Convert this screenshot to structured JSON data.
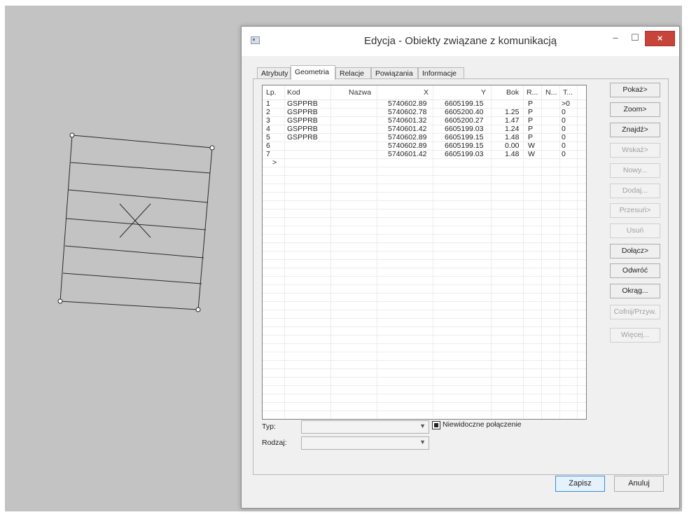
{
  "dialog": {
    "title": "Edycja - Obiekty związane z komunikacją",
    "window_controls": {
      "minimize": "–",
      "maximize": "☐",
      "close": "×"
    }
  },
  "tabs": [
    "Atrybuty",
    "Geometria",
    "Relacje",
    "Powiązania",
    "Informacje"
  ],
  "active_tab": "Geometria",
  "table": {
    "headers": [
      "Lp.",
      "Kod",
      "Nazwa",
      "X",
      "Y",
      "Bok",
      "R...",
      "N...",
      "T..."
    ],
    "rows": [
      [
        "1",
        "GSPPRB",
        "",
        "5740602.89",
        "6605199.15",
        "",
        "P",
        "",
        ">0"
      ],
      [
        "2",
        "GSPPRB",
        "",
        "5740602.78",
        "6605200.40",
        "1.25",
        "P",
        "",
        "0"
      ],
      [
        "3",
        "GSPPRB",
        "",
        "5740601.32",
        "6605200.27",
        "1.47",
        "P",
        "",
        "0"
      ],
      [
        "4",
        "GSPPRB",
        "",
        "5740601.42",
        "6605199.03",
        "1.24",
        "P",
        "",
        "0"
      ],
      [
        "5",
        "GSPPRB",
        "",
        "5740602.89",
        "6605199.15",
        "1.48",
        "P",
        "",
        "0"
      ],
      [
        "6",
        "",
        "",
        "5740602.89",
        "6605199.15",
        "0.00",
        "W",
        "",
        "0"
      ],
      [
        "7",
        "",
        "",
        "5740601.42",
        "6605199.03",
        "1.48",
        "W",
        "",
        "0"
      ]
    ],
    "new_row_marker": ">"
  },
  "fields": {
    "typ_label": "Typ:",
    "typ_value": "",
    "rodzaj_label": "Rodzaj:",
    "rodzaj_value": "",
    "checkbox_label": "Niewidoczne połączenie",
    "checkbox_checked": true
  },
  "side_buttons": [
    {
      "label": "Pokaż>",
      "enabled": true
    },
    {
      "label": "Zoom>",
      "enabled": true
    },
    {
      "label": "Znajdź>",
      "enabled": true
    },
    {
      "label": "Wskaż>",
      "enabled": false
    },
    {
      "label": "Nowy...",
      "enabled": false
    },
    {
      "label": "Dodaj...",
      "enabled": false
    },
    {
      "label": "Przesuń>",
      "enabled": false
    },
    {
      "label": "Usuń",
      "enabled": false
    },
    {
      "label": "Dołącz>",
      "enabled": true
    },
    {
      "label": "Odwróć",
      "enabled": true
    },
    {
      "label": "Okrąg...",
      "enabled": true
    },
    {
      "label": "Cofnij/Przyw.",
      "enabled": false
    },
    {
      "label": "Więcej...",
      "enabled": false
    }
  ],
  "footer": {
    "save_label": "Zapisz",
    "cancel_label": "Anuluj"
  }
}
